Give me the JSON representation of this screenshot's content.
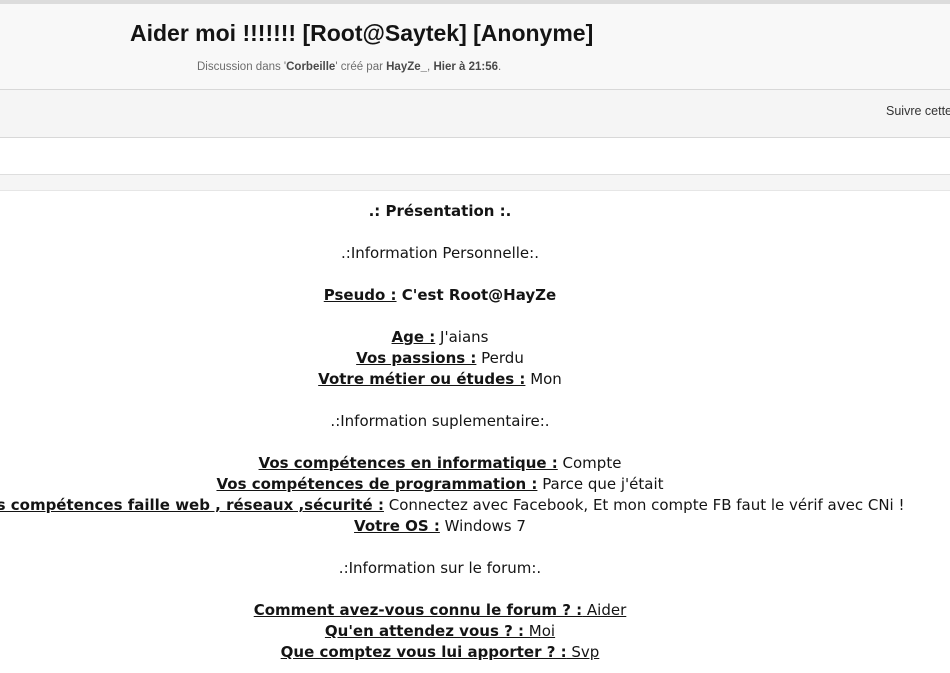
{
  "thread": {
    "title": "Aider moi !!!!!!! [Root@Saytek] [Anonyme]",
    "meta_prefix": "Discussion dans '",
    "meta_forum": "Corbeille",
    "meta_middle": "' créé par ",
    "meta_author": "HayZe_",
    "meta_sep": ", ",
    "meta_date": "Hier à 21:56",
    "meta_end": "."
  },
  "toolbar": {
    "follow_label": "Suivre cette"
  },
  "post": {
    "heading": ".: Présentation :.",
    "section1": ".:Information Personnelle:.",
    "pseudo_label": "Pseudo :",
    "pseudo_value": " C'est Root@HayZe",
    "age_label": "Age :",
    "age_value": " J'aians",
    "passions_label": "Vos passions :",
    "passions_value": " Perdu",
    "metier_label": "Votre métier ou études :",
    "metier_value": " Mon",
    "section2": ".:Information suplementaire:.",
    "info_label": "Vos compétences en informatique :",
    "info_value": " Compte",
    "prog_label": "Vos compétences de programmation :",
    "prog_value": " Parce que j'était",
    "faille_label": "Vos compétences faille web , réseaux ,sécurité :",
    "faille_value": " Connectez avec Facebook, Et mon compte FB faut le vérif avec CNi !",
    "os_label": "Votre OS :",
    "os_value": " Windows 7",
    "section3": ".:Information sur le forum:.",
    "connu_label": "Comment avez-vous connu le forum ? :",
    "connu_value": " Aider",
    "attendez_label": "Qu'en attendez vous ? :",
    "attendez_value": " Moi ",
    "apporter_label": "Que comptez vous lui apporter ? :",
    "apporter_value": " Svp"
  }
}
